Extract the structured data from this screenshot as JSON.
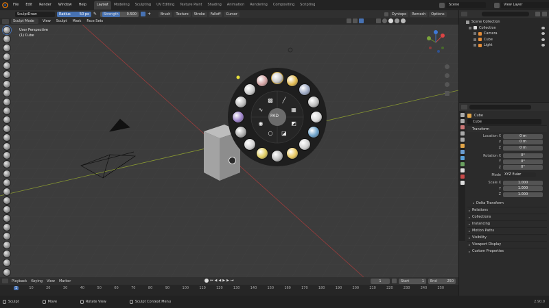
{
  "topbar": {
    "menus": [
      "File",
      "Edit",
      "Render",
      "Window",
      "Help"
    ],
    "workspaces": [
      "Layout",
      "Modeling",
      "Sculpting",
      "UV Editing",
      "Texture Paint",
      "Shading",
      "Animation",
      "Rendering",
      "Compositing",
      "Scripting"
    ],
    "active_workspace": "Layout",
    "scene": "Scene",
    "view_layer": "View Layer"
  },
  "header2": {
    "brush_name": "SculptDraw",
    "radius_label": "Radius",
    "radius_value": "50 px",
    "strength_label": "Strength",
    "strength_value": "0.500",
    "menus": [
      "Brush",
      "Texture",
      "Stroke",
      "Falloff",
      "Cursor"
    ],
    "dyntopo": "Dyntopo",
    "remesh": "Remesh",
    "options": "Options"
  },
  "header3": {
    "mode": "Sculpt Mode",
    "menus": [
      "View",
      "Sculpt",
      "Mask",
      "Face Sets"
    ]
  },
  "viewport": {
    "perspective": "User Perspective",
    "object_info": "(1) Cube",
    "pie_center": "PAD"
  },
  "outliner": {
    "root": "Scene Collection",
    "items": [
      "Collection",
      "Camera",
      "Cube",
      "Light"
    ]
  },
  "properties": {
    "object_name": "Cube",
    "object_field": "Cube",
    "transform_title": "Transform",
    "location": [
      {
        "axis": "Location X",
        "value": "0 m"
      },
      {
        "axis": "Y",
        "value": "0 m"
      },
      {
        "axis": "Z",
        "value": "0 m"
      }
    ],
    "rotation": [
      {
        "axis": "Rotation X",
        "value": "0°"
      },
      {
        "axis": "Y",
        "value": "0°"
      },
      {
        "axis": "Z",
        "value": "0°"
      }
    ],
    "mode_label": "Mode",
    "mode_value": "XYZ Euler",
    "scale": [
      {
        "axis": "Scale X",
        "value": "1.000"
      },
      {
        "axis": "Y",
        "value": "1.000"
      },
      {
        "axis": "Z",
        "value": "1.000"
      }
    ],
    "panels": [
      "Delta Transform",
      "Relations",
      "Collections",
      "Instancing",
      "Motion Paths",
      "Visibility",
      "Viewport Display",
      "Custom Properties"
    ]
  },
  "timeline": {
    "menus": [
      "Playback",
      "Keying",
      "View",
      "Marker"
    ],
    "current_frame": "1",
    "start_label": "Start",
    "start_value": "1",
    "end_label": "End",
    "end_value": "250",
    "ticks": [
      "1",
      "10",
      "20",
      "30",
      "40",
      "50",
      "60",
      "70",
      "80",
      "90",
      "100",
      "110",
      "120",
      "130",
      "140",
      "150",
      "160",
      "170",
      "180",
      "190",
      "200",
      "210",
      "220",
      "230",
      "240",
      "250"
    ]
  },
  "statusbar": {
    "items": [
      "Sculpt",
      "Move",
      "Rotate View",
      "Sculpt Context Menu"
    ],
    "version": "2.90.0"
  },
  "colors": {
    "accent": "#4772b3",
    "viewport_bg": "#3c3c3c",
    "panel_bg": "#2b2b2b"
  }
}
